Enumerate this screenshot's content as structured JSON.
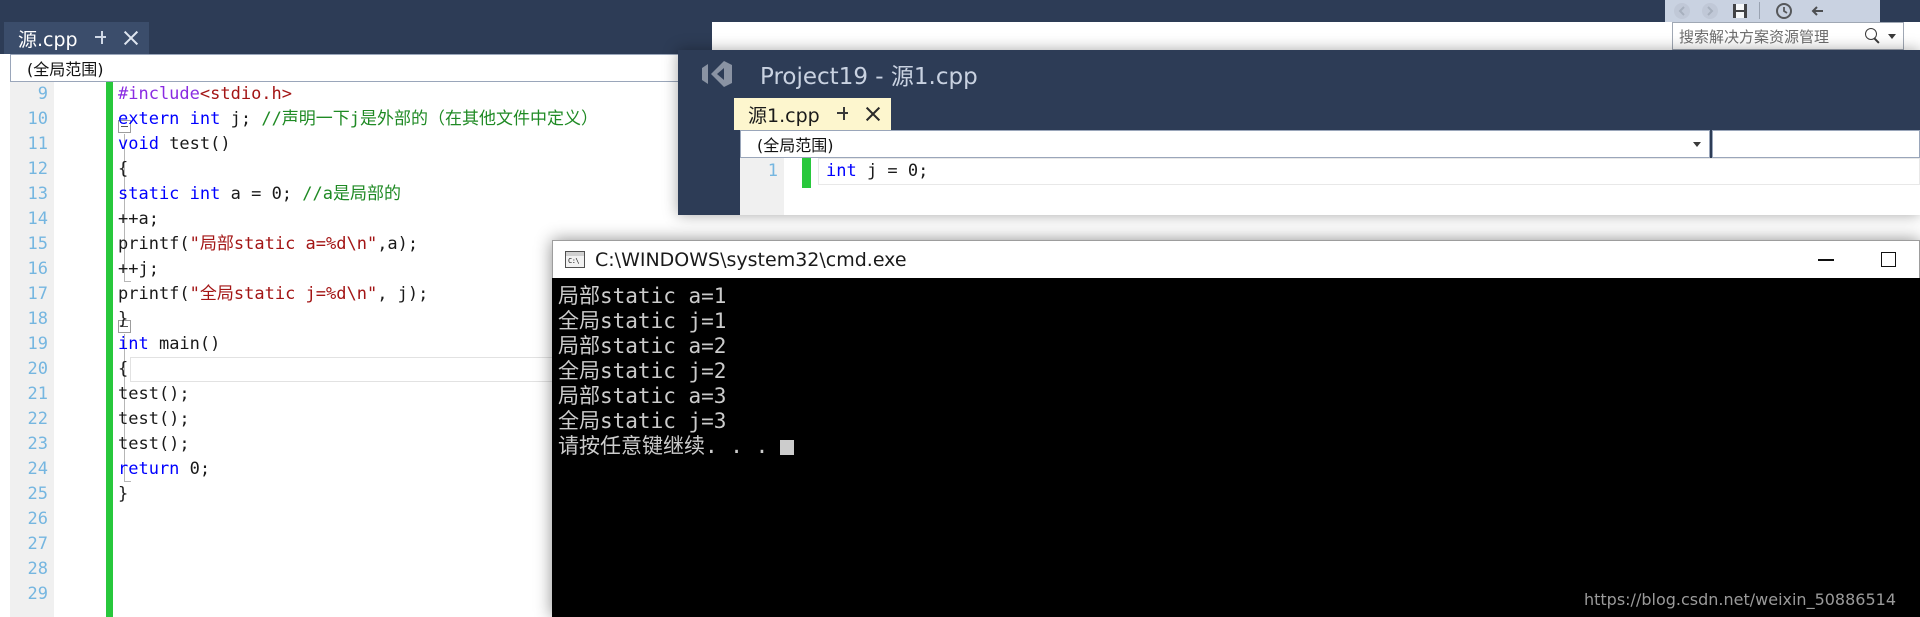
{
  "background_window": {
    "tab": {
      "label": "源.cpp",
      "pin_icon": "pin-icon",
      "close_icon": "close-icon"
    },
    "scope_bar": {
      "value": "(全局范围)"
    },
    "solution_search": {
      "placeholder": "搜索解决方案资源管理",
      "search_icon": "search-icon",
      "dropdown_icon": "chevron-down-icon"
    },
    "toolbar_icons": [
      "back-icon",
      "forward-icon",
      "save-all-icon",
      "history-icon",
      "undo-icon"
    ],
    "code_lines": [
      {
        "num": "9",
        "tokens": [
          {
            "t": "#include",
            "c": "pp"
          },
          {
            "t": "<stdio.h>",
            "c": "inc"
          }
        ]
      },
      {
        "num": "10",
        "tokens": [
          {
            "t": "extern ",
            "c": "k"
          },
          {
            "t": "int",
            "c": "k"
          },
          {
            "t": " j;  ",
            "c": ""
          },
          {
            "t": "//声明一下j是外部的（在其他文件中定义）",
            "c": "cm"
          }
        ]
      },
      {
        "num": "11",
        "tokens": [
          {
            "t": "void",
            "c": "k"
          },
          {
            "t": " test()",
            "c": ""
          }
        ]
      },
      {
        "num": "12",
        "tokens": [
          {
            "t": "{",
            "c": ""
          }
        ]
      },
      {
        "num": "13",
        "tokens": [
          {
            "t": "    ",
            "c": ""
          },
          {
            "t": "static",
            "c": "k"
          },
          {
            "t": " ",
            "c": ""
          },
          {
            "t": "int",
            "c": "k"
          },
          {
            "t": " a = 0; ",
            "c": ""
          },
          {
            "t": "//a是局部的",
            "c": "cm"
          }
        ]
      },
      {
        "num": "14",
        "tokens": [
          {
            "t": "    ++a;",
            "c": ""
          }
        ]
      },
      {
        "num": "15",
        "tokens": [
          {
            "t": "    printf(",
            "c": ""
          },
          {
            "t": "\"局部static a=%d\\n\"",
            "c": "str"
          },
          {
            "t": ",a);",
            "c": ""
          }
        ]
      },
      {
        "num": "16",
        "tokens": [
          {
            "t": "    ++j;",
            "c": ""
          }
        ]
      },
      {
        "num": "17",
        "tokens": [
          {
            "t": "    printf(",
            "c": ""
          },
          {
            "t": "\"全局static j=%d\\n\"",
            "c": "str"
          },
          {
            "t": ", j);",
            "c": ""
          }
        ]
      },
      {
        "num": "18",
        "tokens": [
          {
            "t": "}",
            "c": ""
          }
        ]
      },
      {
        "num": "19",
        "tokens": [
          {
            "t": "int",
            "c": "k"
          },
          {
            "t": " main()",
            "c": ""
          }
        ]
      },
      {
        "num": "20",
        "tokens": [
          {
            "t": "{",
            "c": ""
          }
        ]
      },
      {
        "num": "21",
        "tokens": [
          {
            "t": "    test();",
            "c": ""
          }
        ]
      },
      {
        "num": "22",
        "tokens": [
          {
            "t": "    test();",
            "c": ""
          }
        ]
      },
      {
        "num": "23",
        "tokens": [
          {
            "t": "    test();",
            "c": ""
          }
        ]
      },
      {
        "num": "24",
        "tokens": [
          {
            "t": "    ",
            "c": ""
          },
          {
            "t": "return",
            "c": "k"
          },
          {
            "t": " 0;",
            "c": ""
          }
        ]
      },
      {
        "num": "25",
        "tokens": [
          {
            "t": "}",
            "c": ""
          }
        ]
      },
      {
        "num": "26",
        "tokens": []
      },
      {
        "num": "27",
        "tokens": []
      },
      {
        "num": "28",
        "tokens": []
      },
      {
        "num": "29",
        "tokens": []
      }
    ]
  },
  "vs_window": {
    "title": "Project19 - 源1.cpp",
    "logo_icon": "visual-studio-logo-icon",
    "tab": {
      "label": "源1.cpp",
      "pin_icon": "pin-icon",
      "close_icon": "close-icon"
    },
    "scope_bar": {
      "value": "(全局范围)",
      "dropdown_icon": "chevron-down-icon"
    },
    "code_lines": [
      {
        "num": "1",
        "tokens": [
          {
            "t": "int",
            "c": "k"
          },
          {
            "t": " j = 0;",
            "c": ""
          }
        ]
      }
    ]
  },
  "console_window": {
    "title": "C:\\WINDOWS\\system32\\cmd.exe",
    "icon": "console-icon",
    "minimize_label": "minimize-icon",
    "maximize_label": "maximize-icon",
    "output_lines": [
      "局部static a=1",
      "全局static j=1",
      "局部static a=2",
      "全局static j=2",
      "局部static a=3",
      "全局static j=3"
    ],
    "prompt_line": "请按任意键继续. . .",
    "cursor": "block-cursor"
  },
  "watermark": {
    "text": "https://blog.csdn.net/weixin_50886514"
  },
  "colors": {
    "vs_chrome": "#2d3c56",
    "tab_active_back": "#3b4d6b",
    "tab_active_front": "#fdf6ce",
    "change_bar_green": "#28c83c",
    "keyword_blue": "#0000ff",
    "string_red": "#a31515",
    "comment_green": "#1f8a24",
    "preproc_purple": "#8a2be2",
    "line_number": "#75b6e0",
    "console_bg": "#000000",
    "console_fg": "#cccccc"
  }
}
